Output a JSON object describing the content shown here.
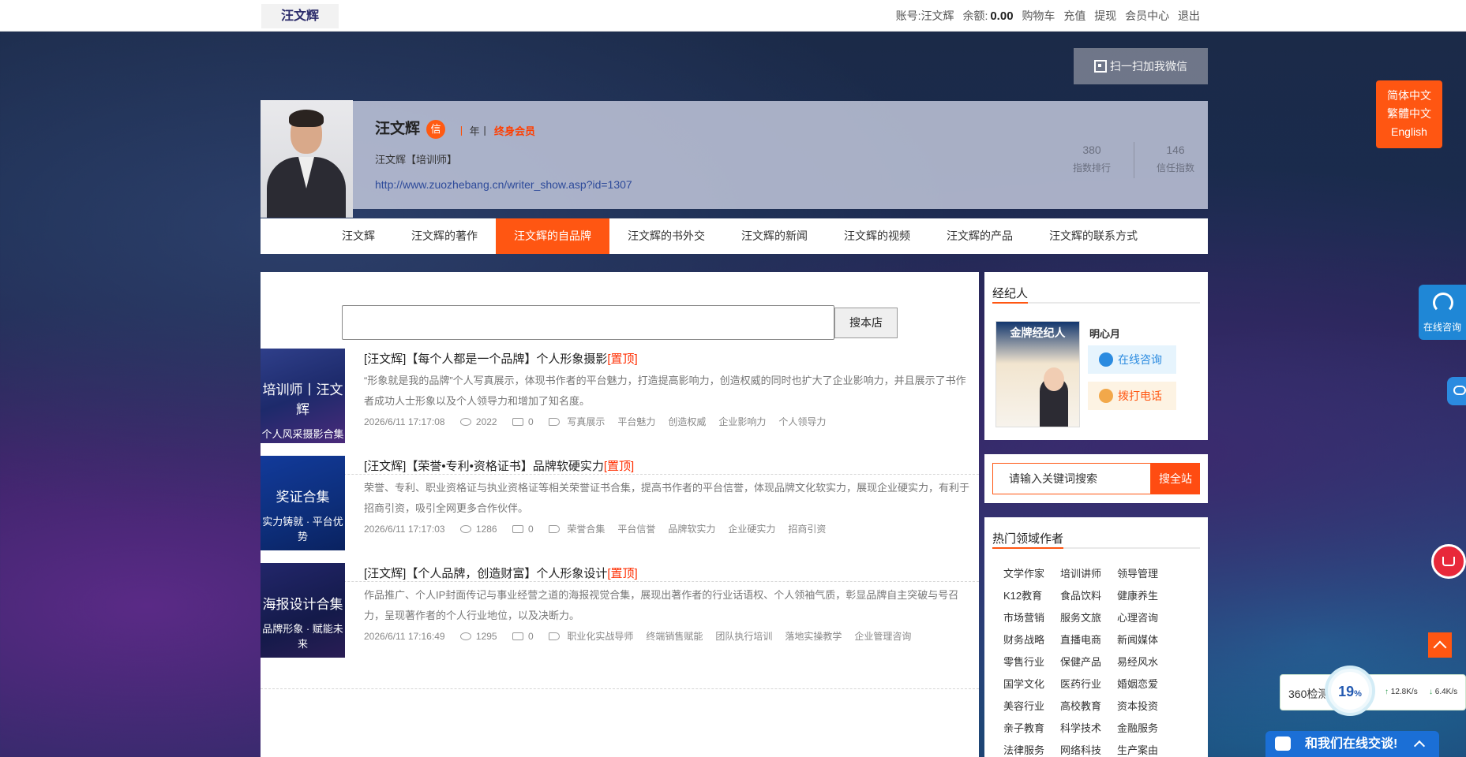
{
  "topbar": {
    "logo": "汪文辉",
    "account_label": "账号:",
    "account_name": "汪文辉",
    "balance_label": "余额:",
    "balance": "0.00",
    "links": [
      "购物车",
      "充值",
      "提现",
      "会员中心",
      "退出"
    ]
  },
  "wechat_btn": "扫一扫加我微信",
  "profile": {
    "name": "汪文辉",
    "badge": "信",
    "year_sep1": "丨",
    "year": "年",
    "year_sep2": "丨",
    "vip": "终身会员",
    "title": "汪文辉【培训师】",
    "url": "http://www.zuozhebang.cn/writer_show.asp?id=1307",
    "stats": [
      {
        "value": "380",
        "label": "指数排行"
      },
      {
        "value": "146",
        "label": "信任指数"
      }
    ]
  },
  "nav": [
    "汪文辉",
    "汪文辉的著作",
    "汪文辉的自品牌",
    "汪文辉的书外交",
    "汪文辉的新闻",
    "汪文辉的视频",
    "汪文辉的产品",
    "汪文辉的联系方式"
  ],
  "nav_active": 2,
  "shop_search": {
    "button": "搜本店",
    "placeholder": ""
  },
  "posts": [
    {
      "thumb_title": "培训师丨汪文辉",
      "thumb_sub": "个人风采摄影合集",
      "thumb_color": "#1d2a6b",
      "title": "[汪文辉]【每个人都是一个品牌】个人形象摄影",
      "top": "[置顶]",
      "desc": "“形象就是我的品牌”个人写真展示，体现书作者的平台魅力，打造提高影响力，创造权威的同时也扩大了企业影响力，并且展示了书作者成功人士形象以及个人领导力和增加了知名度。",
      "date": "2026/6/11 17:17:08",
      "views": "2022",
      "comments": "0",
      "tags": [
        "写真展示",
        "平台魅力",
        "创造权威",
        "企业影响力",
        "个人领导力"
      ]
    },
    {
      "thumb_title": "奖证合集",
      "thumb_sub": "实力铸就 · 平台优势",
      "thumb_color": "#0d2e7a",
      "title": "[汪文辉]【荣誉•专利•资格证书】品牌软硬实力",
      "top": "[置顶]",
      "desc": "荣誉、专利、职业资格证与执业资格证等相关荣誉证书合集，提高书作者的平台信誉，体现品牌文化软实力，展现企业硬实力，有利于招商引资，吸引全网更多合作伙伴。",
      "date": "2026/6/11 17:17:03",
      "views": "1286",
      "comments": "0",
      "tags": [
        "荣誉合集",
        "平台信誉",
        "品牌软实力",
        "企业硬实力",
        "招商引资"
      ]
    },
    {
      "thumb_title": "海报设计合集",
      "thumb_sub": "品牌形象 · 赋能未来",
      "thumb_color": "#141a4a",
      "title": "[汪文辉]【个人品牌，创造财富】个人形象设计",
      "top": "[置顶]",
      "desc": "作品推广、个人IP封面传记与事业经营之道的海报视觉合集，展现出著作者的行业话语权、个人领袖气质，彰显品牌自主突破与号召力，呈现著作者的个人行业地位，以及决断力。",
      "date": "2026/6/11 17:16:49",
      "views": "1295",
      "comments": "0",
      "tags": [
        "职业化实战导师",
        "终端销售赋能",
        "团队执行培训",
        "落地实操教学",
        "企业管理咨询"
      ]
    }
  ],
  "agent": {
    "heading": "经纪人",
    "img_caption": "金牌经纪人",
    "name": "明心月",
    "consult": "在线咨询",
    "call": "拨打电话"
  },
  "site_search": {
    "placeholder": "请输入关键词搜索",
    "button": "搜全站"
  },
  "hot": {
    "heading": "热门领域作者",
    "tags": [
      "文学作家",
      "培训讲师",
      "领导管理",
      "K12教育",
      "食品饮料",
      "健康养生",
      "市场营销",
      "服务文旅",
      "心理咨询",
      "财务战略",
      "直播电商",
      "新闻媒体",
      "零售行业",
      "保健产品",
      "易经风水",
      "国学文化",
      "医药行业",
      "婚姻恋爱",
      "美容行业",
      "高校教育",
      "资本投资",
      "亲子教育",
      "科学技术",
      "金融服务",
      "法律服务",
      "网络科技",
      "生产案由"
    ]
  },
  "lang": [
    "简体中文",
    "繁體中文",
    "English"
  ],
  "floating": {
    "consult": "在线咨询",
    "speed_label": "360检测",
    "speed_pct": "19",
    "up": "12.8K/s",
    "down": "6.4K/s",
    "chat": "和我们在线交谈!"
  },
  "colors": {
    "accent": "#ff5612",
    "link": "#2d4a9a",
    "top_red": "#ff2d00",
    "chat_blue": "#1b6fd6"
  }
}
